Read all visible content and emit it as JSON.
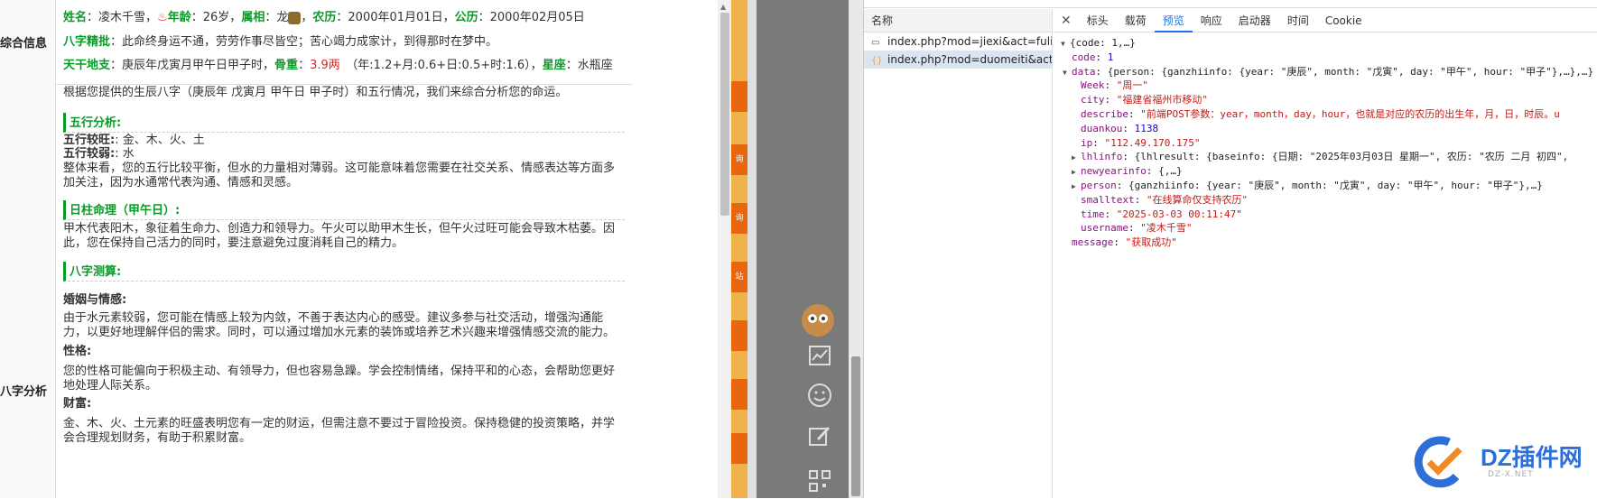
{
  "left": {
    "section1_label": "综合信息",
    "section2_label": "八字分析",
    "line1": {
      "k_name": "姓名",
      "name": "凌木千雪",
      "k_age": "年龄",
      "age": "26岁",
      "k_shu": "属相",
      "shu": "龙",
      "k_nongli": "农历",
      "nongli": "2000年01月01日",
      "k_gongli": "公历",
      "gongli": "2000年02月05日"
    },
    "line2": {
      "k": "八字精批",
      "v": "此命终身运不通，劳劳作事尽皆空；苦心竭力成家计，到得那时在梦中。"
    },
    "line3": {
      "k": "天干地支",
      "v": "庚辰年戊寅月甲午日甲子时，",
      "k_gu": "骨重",
      "gu": "3.9两",
      "gu_detail": "（年:1.2+月:0.6+日:0.5+时:1.6），",
      "k_xz": "星座",
      "xz": "水瓶座"
    },
    "intro": "根据您提供的生辰八字（庚辰年 戊寅月 甲午日 甲子时）和五行情况，我们来综合分析您的命运。",
    "h_wuxing": "五行分析:",
    "wx_strong_k": "五行较旺:",
    "wx_strong_v": ": 金、木、火、土",
    "wx_weak_k": "五行较弱:",
    "wx_weak_v": ": 水",
    "wx_para": "整体来看，您的五行比较平衡，但水的力量相对薄弱。这可能意味着您需要在社交关系、情感表达等方面多加关注，因为水通常代表沟通、情感和灵感。",
    "h_rizhu": "日柱命理（甲午日）:",
    "rizhu_para": "甲木代表阳木，象征着生命力、创造力和领导力。午火可以助甲木生长，但午火过旺可能会导致木枯萎。因此，您在保持自己活力的同时，要注意避免过度消耗自己的精力。",
    "h_bazi": "八字测算:",
    "marriage_h": "婚姻与情感:",
    "marriage_para": "由于水元素较弱，您可能在情感上较为内敛，不善于表达内心的感受。建议多参与社交活动，增强沟通能力，以更好地理解伴侣的需求。同时，可以通过增加水元素的装饰或培养艺术兴趣来增强情感交流的能力。",
    "xingge_h": "性格:",
    "xingge_para": "您的性格可能偏向于积极主动、有领导力，但也容易急躁。学会控制情绪，保持平和的心态，会帮助您更好地处理人际关系。",
    "caifu_h": "财富:",
    "caifu_para": "金、木、火、土元素的旺盛表明您有一定的财运，但需注意不要过于冒险投资。保持稳健的投资策略，并学会合理规划财务，有助于积累财富。"
  },
  "middle": {
    "side_buttons": [
      "",
      "",
      "询",
      "询",
      "",
      "站",
      "",
      "",
      ""
    ],
    "icons": [
      "avatar-icon",
      "chart-icon",
      "smile-icon",
      "edit-icon",
      "qrcode-icon"
    ]
  },
  "devtools": {
    "name_header": "名称",
    "requests": [
      {
        "name": "index.php?mod=jiexi&act=fulicai",
        "icon": "document-icon",
        "selected": false
      },
      {
        "name": "index.php?mod=duomeiti&act=...",
        "icon": "xhr-icon",
        "selected": true
      }
    ],
    "tabs": [
      "标头",
      "载荷",
      "预览",
      "响应",
      "启动器",
      "时间",
      "Cookie"
    ],
    "active_tab": "预览",
    "json": {
      "l0": "{code: 1,…}",
      "code_k": "code",
      "code_v": "1",
      "data_k": "data",
      "data_v": "{person: {ganzhiinfo: {year: \"庚辰\", month: \"戊寅\", day: \"甲午\", hour: \"甲子\"},…},…}",
      "week_k": "Week",
      "week_v": "\"周一\"",
      "city_k": "city",
      "city_v": "\"福建省福州市移动\"",
      "describe_k": "describe",
      "describe_v": "\"前端POST参数：year，month，day，hour，也就是对应的农历的出生年，月，日，时辰。u",
      "duankou_k": "duankou",
      "duankou_v": "1138",
      "ip_k": "ip",
      "ip_v": "\"112.49.170.175\"",
      "lhlinfo_k": "lhlinfo",
      "lhlinfo_v": "{lhlresult: {baseinfo: {日期: \"2025年03月03日 星期一\", 农历: \"农历 二月 初四\",",
      "newyear_k": "newyearinfo",
      "newyear_v": "{,…}",
      "person_k": "person",
      "person_v": "{ganzhiinfo: {year: \"庚辰\", month: \"戊寅\", day: \"甲午\", hour: \"甲子\"},…}",
      "smalltext_k": "smalltext",
      "smalltext_v": "\"在线算命仅支持农历\"",
      "time_k": "time",
      "time_v": "\"2025-03-03 00:11:47\"",
      "username_k": "username",
      "username_v": "\"凌木千雪\"",
      "message_k": "message",
      "message_v": "\"获取成功\""
    }
  },
  "watermark": {
    "text": "DZ插件网",
    "sub": "DZ-X.NET"
  }
}
